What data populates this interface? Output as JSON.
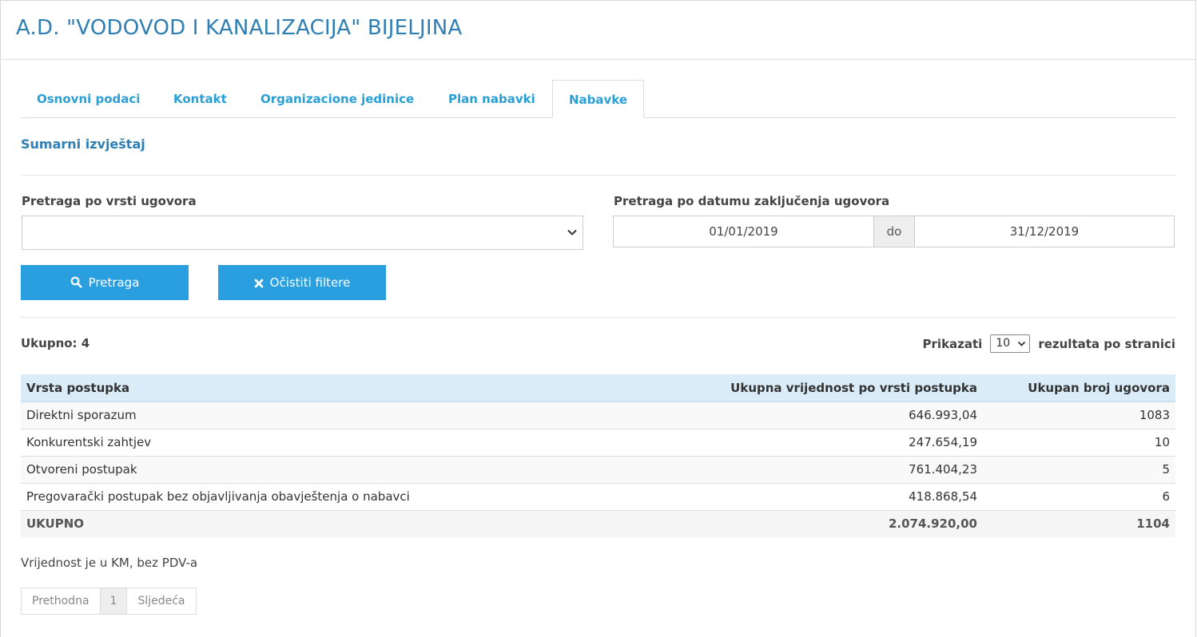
{
  "header": {
    "title": "A.D. \"VODOVOD I KANALIZACIJA\" BIJELJINA"
  },
  "tabs": [
    {
      "label": "Osnovni podaci"
    },
    {
      "label": "Kontakt"
    },
    {
      "label": "Organizacione jedinice"
    },
    {
      "label": "Plan nabavki"
    },
    {
      "label": "Nabavke",
      "active": true
    }
  ],
  "section": {
    "title": "Sumarni izvještaj"
  },
  "filters": {
    "contract_type_label": "Pretraga po vrsti ugovora",
    "contract_type_value": "",
    "date_label": "Pretraga po datumu zaključenja ugovora",
    "date_from": "01/01/2019",
    "date_sep": "do",
    "date_to": "31/12/2019",
    "search_button": "Pretraga",
    "clear_button": "Očistiti filtere"
  },
  "summary": {
    "total_text": "Ukupno: 4",
    "show_label": "Prikazati",
    "per_page_value": "10",
    "per_page_suffix": "rezultata po stranici"
  },
  "table": {
    "headers": [
      "Vrsta postupka",
      "Ukupna vrijednost po vrsti postupka",
      "Ukupan broj ugovora"
    ],
    "rows": [
      [
        "Direktni sporazum",
        "646.993,04",
        "1083"
      ],
      [
        "Konkurentski zahtjev",
        "247.654,19",
        "10"
      ],
      [
        "Otvoreni postupak",
        "761.404,23",
        "5"
      ],
      [
        "Pregovarački postupak bez objavljivanja obavještenja o nabavci",
        "418.868,54",
        "6"
      ]
    ],
    "total": [
      "UKUPNO",
      "2.074.920,00",
      "1104"
    ]
  },
  "footnote": "Vrijednost je u KM, bez PDV-a",
  "pagination": {
    "prev": "Prethodna",
    "current": "1",
    "next": "Sljedeća"
  },
  "colors": {
    "accent": "#2a9fe0",
    "title": "#2f7fb5",
    "table_header": "#d9ecf7"
  }
}
